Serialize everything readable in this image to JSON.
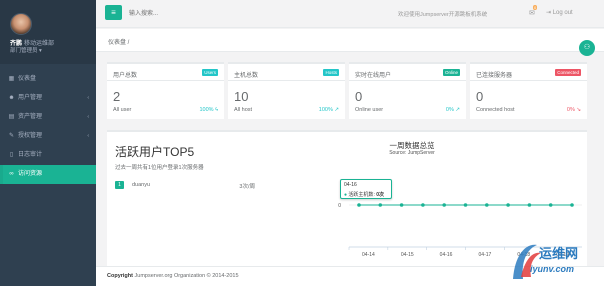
{
  "sidebar": {
    "profile_name": "齐鹏",
    "profile_title": "移动运维部",
    "profile_role": "部门管理员 ▾",
    "items": [
      {
        "label": "仪表盘",
        "icon": "dashboard-icon"
      },
      {
        "label": "用户管理",
        "icon": "users-icon"
      },
      {
        "label": "资产管理",
        "icon": "inbox-icon"
      },
      {
        "label": "授权管理",
        "icon": "edit-icon"
      },
      {
        "label": "日志审计",
        "icon": "files-icon"
      },
      {
        "label": "访问资源",
        "icon": "link-icon"
      }
    ],
    "active_index": 5
  },
  "topbar": {
    "search_placeholder": "输入搜索...",
    "welcome": "欢迎使用Jumpserver开源跳板机系统",
    "mail_badge": "0",
    "logout": "Log out"
  },
  "breadcrumb": "仪表盘 /",
  "stats": [
    {
      "title": "用户总数",
      "badge": "Users",
      "badge_color": "#23c6c8",
      "value": "2",
      "label": "All user",
      "pct": "100% ϟ",
      "pct_color": "#23c6c8"
    },
    {
      "title": "主机总数",
      "badge": "Hosts",
      "badge_color": "#23c6c8",
      "value": "10",
      "label": "All host",
      "pct": "100% ↗",
      "pct_color": "#23c6c8"
    },
    {
      "title": "实时在线用户",
      "badge": "Online",
      "badge_color": "#1ab394",
      "value": "0",
      "label": "Online user",
      "pct": "0% ↗",
      "pct_color": "#23c6c8"
    },
    {
      "title": "已连接服务器",
      "badge": "Connected",
      "badge_color": "#ed5565",
      "value": "0",
      "label": "Connected host",
      "pct": "0% ↘",
      "pct_color": "#ed5565"
    }
  ],
  "panel": {
    "title": "活跃用户TOP5",
    "subtitle": "过去一周共有1位用户登录1次服务器",
    "users": [
      {
        "rank": "1",
        "name": "duanyu",
        "count": "3次/周"
      }
    ]
  },
  "chart_data": {
    "type": "line",
    "title": "一周数据总览",
    "subtitle": "Source: JumpServer",
    "categories": [
      "04-14",
      "04-15",
      "04-16",
      "04-17",
      "04-18",
      "04-19"
    ],
    "series": [
      {
        "name": "活跃主机数",
        "values": [
          0,
          0,
          0,
          0,
          0,
          0,
          0,
          0,
          0,
          0,
          0
        ],
        "color": "#1ab394"
      }
    ],
    "y_tick": "0",
    "tooltip": {
      "date": "04-16",
      "series": "活跃主机数",
      "value": "0次"
    }
  },
  "footer": {
    "copyright": "Copyright",
    "text": "Jumpserver.org Organization © 2014-2015"
  },
  "watermark": {
    "cn": "运维网",
    "en": "iyunv.com"
  }
}
